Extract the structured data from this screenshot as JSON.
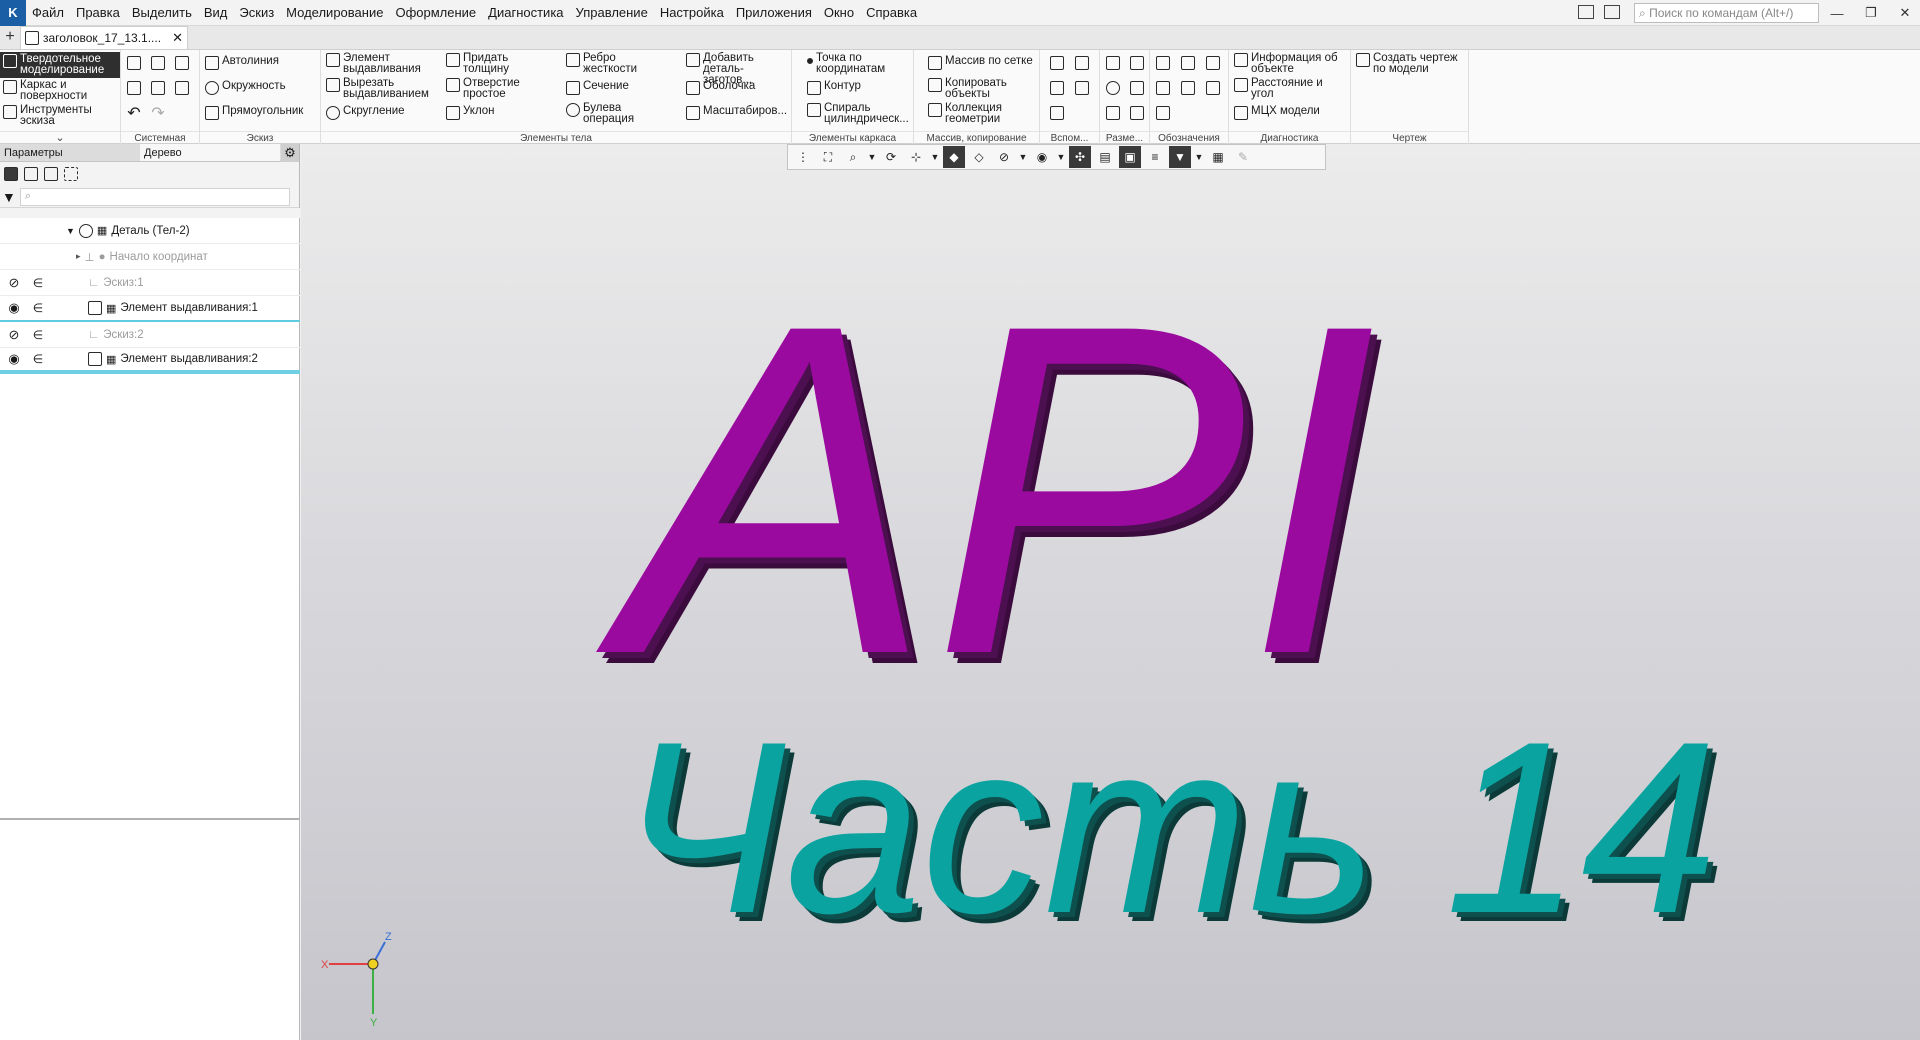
{
  "app": {
    "logo": "K"
  },
  "menu": [
    "Файл",
    "Правка",
    "Выделить",
    "Вид",
    "Эскиз",
    "Моделирование",
    "Оформление",
    "Диагностика",
    "Управление",
    "Настройка",
    "Приложения",
    "Окно",
    "Справка"
  ],
  "search": {
    "placeholder": "Поиск по командам (Alt+/)"
  },
  "window_buttons": {
    "minimize": "—",
    "restore": "❐",
    "close": "✕"
  },
  "tabs": {
    "new": "+",
    "doc_title": "заголовок_17_13.1....",
    "close": "✕"
  },
  "ribbon": {
    "modes": [
      "Твердотельное моделирование",
      "Каркас и поверхности",
      "Инструменты эскиза"
    ],
    "groups": {
      "system": "Системная",
      "sketch": "Эскиз",
      "body": "Элементы тела",
      "frame": "Элементы каркаса",
      "array": "Массив, копирование",
      "aux": "Вспом...",
      "dims": "Разме...",
      "marks": "Обозначения",
      "diag": "Диагностика",
      "drawing": "Чертеж"
    },
    "sketch_buttons": [
      "Автолиния",
      "Окружность",
      "Прямоугольник"
    ],
    "body_buttons": [
      "Элемент выдавливания",
      "Вырезать выдавливанием",
      "Скругление",
      "Придать толщину",
      "Отверстие простое",
      "Уклон",
      "Ребро жесткости",
      "Сечение",
      "Булева операция",
      "Добавить деталь-заготов...",
      "Оболочка",
      "Масштабиров..."
    ],
    "frame_buttons": [
      "Точка по координатам",
      "Контур",
      "Спираль цилиндрическ..."
    ],
    "array_buttons": [
      "Массив по сетке",
      "Копировать объекты",
      "Коллекция геометрии"
    ],
    "diag_buttons": [
      "Информация об объекте",
      "Расстояние и угол",
      "МЦХ модели"
    ],
    "drawing_buttons": [
      "Создать чертеж по модели"
    ]
  },
  "panel": {
    "tabs": [
      "Параметры",
      "Дерево"
    ],
    "gear": "⚙",
    "filter_placeholder": "⌕",
    "tree": [
      {
        "label": "Деталь (Тел-2)",
        "style": "normal"
      },
      {
        "label": "Начало координат",
        "style": "grey"
      },
      {
        "label": "Эскиз:1",
        "style": "grey"
      },
      {
        "label": "Элемент выдавливания:1",
        "style": "normal"
      },
      {
        "label": "Эскиз:2",
        "style": "grey"
      },
      {
        "label": "Элемент выдавливания:2",
        "style": "normal"
      }
    ]
  },
  "model": {
    "line1": "API",
    "line2": "Часть 14",
    "line1_color": "#9b0a9e",
    "line2_color": "#0aa3a0"
  },
  "axes": {
    "x": "X",
    "y": "Y",
    "z": "Z"
  }
}
